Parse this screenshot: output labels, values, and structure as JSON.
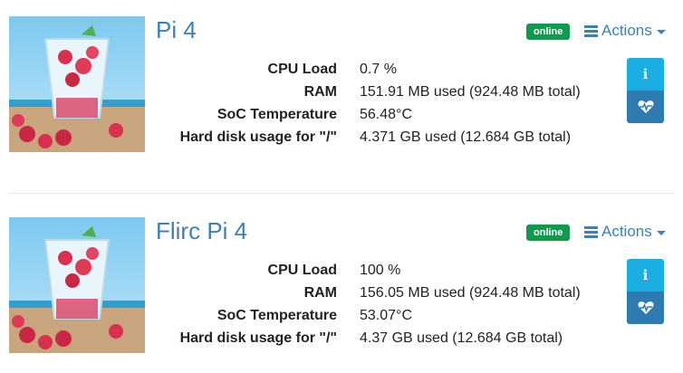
{
  "devices": [
    {
      "name": "Pi 4",
      "status": "online",
      "actions_label": "Actions",
      "stats": [
        {
          "label": "CPU Load",
          "value": "0.7 %"
        },
        {
          "label": "RAM",
          "value": "151.91 MB used (924.48 MB total)"
        },
        {
          "label": "SoC Temperature",
          "value": "56.48°C"
        },
        {
          "label": "Hard disk usage for \"/\"",
          "value": "4.371 GB used (12.684 GB total)"
        }
      ],
      "info_icon": "i"
    },
    {
      "name": "Flirc Pi 4",
      "status": "online",
      "actions_label": "Actions",
      "stats": [
        {
          "label": "CPU Load",
          "value": "100 %"
        },
        {
          "label": "RAM",
          "value": "156.05 MB used (924.48 MB total)"
        },
        {
          "label": "SoC Temperature",
          "value": "53.07°C"
        },
        {
          "label": "Hard disk usage for \"/\"",
          "value": "4.37 GB used (12.684 GB total)"
        }
      ],
      "info_icon": "i"
    }
  ],
  "colors": {
    "title": "#3a82b5",
    "badge": "#109a4e",
    "info_button": "#1aaee2",
    "health_button": "#2d7bb0"
  },
  "icons": [
    "list-icon",
    "caret-down-icon",
    "info-icon",
    "heartbeat-icon"
  ]
}
